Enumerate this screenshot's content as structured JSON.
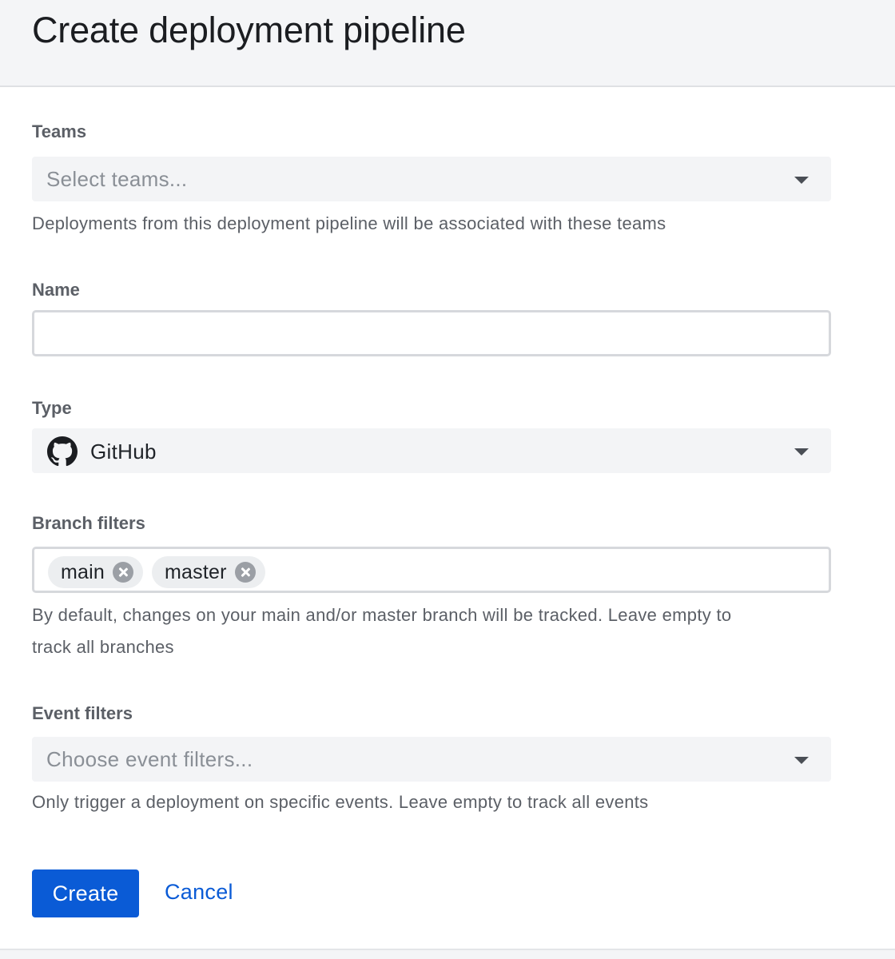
{
  "page": {
    "title": "Create deployment pipeline"
  },
  "teams": {
    "label": "Teams",
    "placeholder": "Select teams...",
    "help": "Deployments from this deployment pipeline will be associated with these teams"
  },
  "name": {
    "label": "Name",
    "value": "",
    "placeholder": ""
  },
  "type": {
    "label": "Type",
    "value": "GitHub",
    "icon": "github-icon"
  },
  "branch_filters": {
    "label": "Branch filters",
    "chips": [
      {
        "label": "main"
      },
      {
        "label": "master"
      }
    ],
    "help_line1": "By default, changes on your main and/or master branch will be tracked. Leave empty to",
    "help_line2": "track all branches"
  },
  "event_filters": {
    "label": "Event filters",
    "placeholder": "Choose event filters...",
    "help": "Only trigger a deployment on specific events. Leave empty to track all events"
  },
  "actions": {
    "create_label": "Create",
    "cancel_label": "Cancel"
  },
  "colors": {
    "primary": "#0a5bd6",
    "header_bg": "#f4f5f7",
    "field_bg": "#f3f4f6"
  }
}
